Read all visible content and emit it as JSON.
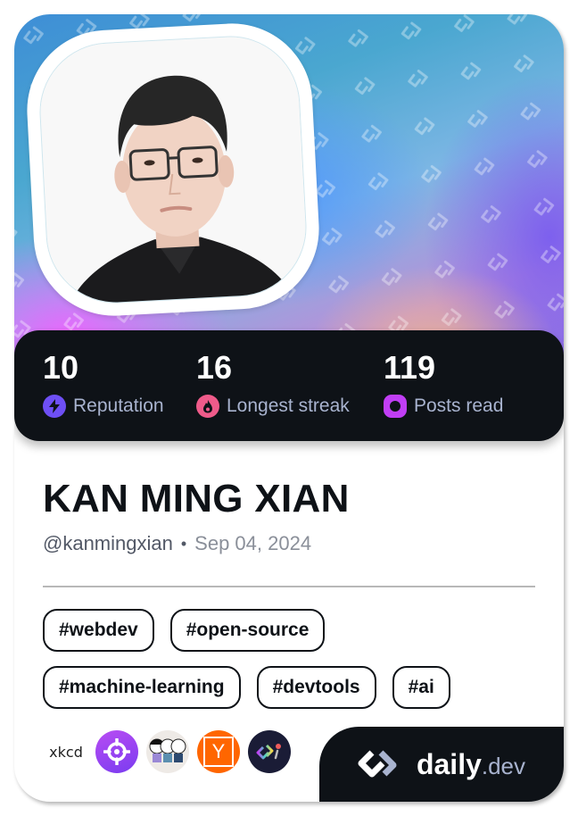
{
  "profile": {
    "name": "KAN MING XIAN",
    "handle": "@kanmingxian",
    "separator": "•",
    "joined_date": "Sep 04, 2024",
    "avatar_alt": "profile-photo"
  },
  "stats": [
    {
      "value": "10",
      "label": "Reputation",
      "icon": "lightning-icon",
      "color": "#6e4ff5"
    },
    {
      "value": "16",
      "label": "Longest streak",
      "icon": "flame-icon",
      "color": "#ef5b8a"
    },
    {
      "value": "119",
      "label": "Posts read",
      "icon": "ring-icon",
      "color": "#c13ef5"
    }
  ],
  "tags": {
    "row1": [
      "#webdev",
      "#open-source"
    ],
    "row2": [
      "#machine-learning",
      "#devtools",
      "#ai"
    ]
  },
  "sources": [
    {
      "name": "xkcd",
      "text": "xkcd"
    },
    {
      "name": "target-source",
      "color": "#9b3cf0"
    },
    {
      "name": "cartoon-source",
      "color": "#eeeae6"
    },
    {
      "name": "hacker-news",
      "text": "Y",
      "color": "#ff6600"
    },
    {
      "name": "daily-dev-source",
      "color": "#1a1c36"
    }
  ],
  "brand": {
    "name": "daily",
    "suffix": ".dev"
  },
  "colors": {
    "dark": "#0e1217",
    "muted_label": "#a8b3cf"
  }
}
